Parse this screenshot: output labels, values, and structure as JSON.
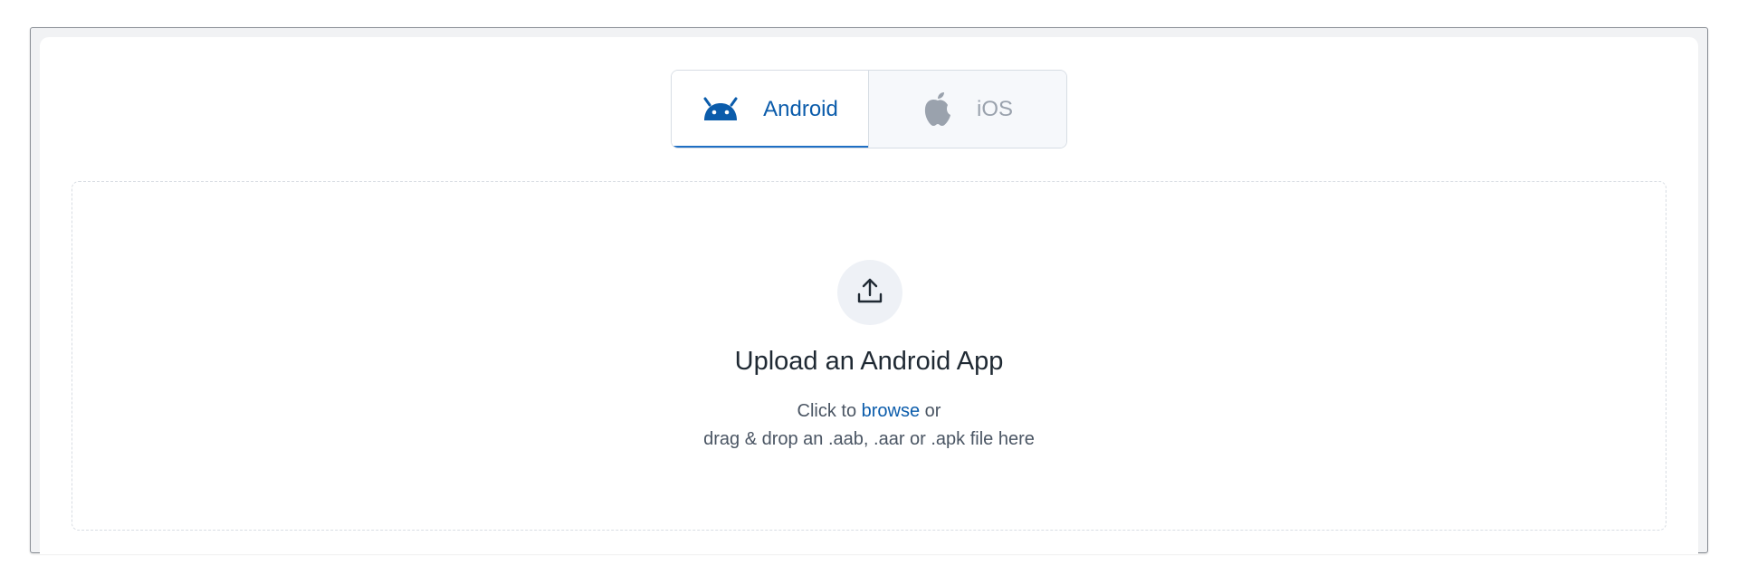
{
  "tabs": {
    "android": {
      "label": "Android",
      "icon": "android-icon",
      "selected": true
    },
    "ios": {
      "label": "iOS",
      "icon": "apple-icon",
      "selected": false
    }
  },
  "upload": {
    "icon": "upload-icon",
    "title": "Upload an Android App",
    "line1_prefix": "Click to ",
    "browse_label": "browse",
    "line1_suffix": " or",
    "line2": "drag & drop an .aab, .aar or .apk file here"
  },
  "colors": {
    "accent": "#0b5cab",
    "inactive_text": "#9aa2ad",
    "title_text": "#1f2933",
    "body_text": "#4a5563",
    "upload_circle_bg": "#eef1f6"
  }
}
